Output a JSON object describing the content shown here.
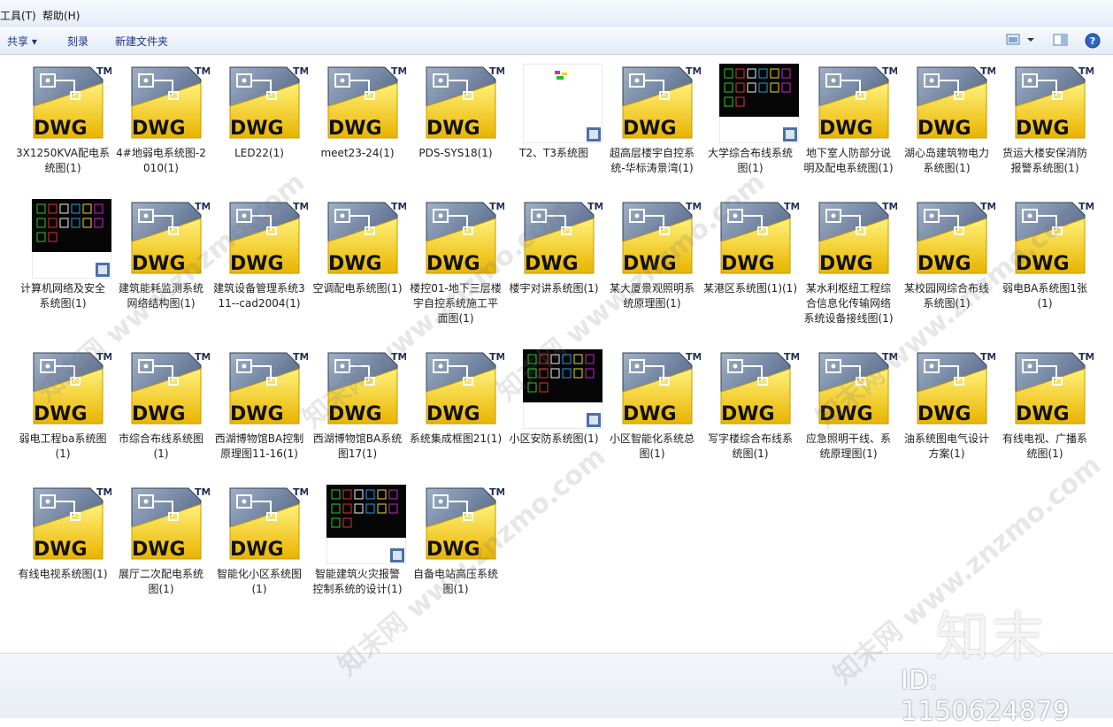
{
  "menu": {
    "tools": "工具(T)",
    "help": "帮助(H)"
  },
  "toolbar": {
    "share": "共享 ▾",
    "burn": "刻录",
    "new_folder": "新建文件夹"
  },
  "dwg_text": "DWG",
  "tm_text": "TM",
  "files": [
    {
      "type": "dwg",
      "label": "3X1250KVA配电系统图(1)"
    },
    {
      "type": "dwg",
      "label": "4#地弱电系统图-2010(1)"
    },
    {
      "type": "dwg",
      "label": "LED22(1)"
    },
    {
      "type": "dwg",
      "label": "meet23-24(1)"
    },
    {
      "type": "dwg",
      "label": "PDS-SYS18(1)"
    },
    {
      "type": "thumb-white",
      "label": "T2、T3系统图"
    },
    {
      "type": "dwg",
      "label": "超高层楼宇自控系统-华标涛景湾(1)"
    },
    {
      "type": "thumb-dark",
      "label": "大学综合布线系统图(1)"
    },
    {
      "type": "dwg",
      "label": "地下室人防部分说明及配电系统图(1)"
    },
    {
      "type": "dwg",
      "label": "湖心岛建筑物电力系统图(1)"
    },
    {
      "type": "dwg",
      "label": "货运大楼安保消防报警系统图(1)"
    },
    {
      "type": "thumb-dark",
      "label": "计算机网络及安全系统图(1)"
    },
    {
      "type": "dwg",
      "label": "建筑能耗监测系统网络结构图(1)"
    },
    {
      "type": "dwg",
      "label": "建筑设备管理系统311--cad2004(1)"
    },
    {
      "type": "dwg",
      "label": "空调配电系统图(1)"
    },
    {
      "type": "dwg",
      "label": "楼控01-地下三层楼宇自控系统施工平面图(1)"
    },
    {
      "type": "dwg",
      "label": "楼宇对讲系统图(1)"
    },
    {
      "type": "dwg",
      "label": "某大厦景观照明系统原理图(1)"
    },
    {
      "type": "dwg",
      "label": "某港区系统图(1)(1)"
    },
    {
      "type": "dwg",
      "label": "某水利枢纽工程综合信息化传输网络系统设备接线图(1)"
    },
    {
      "type": "dwg",
      "label": "某校园网综合布线系统图(1)"
    },
    {
      "type": "dwg",
      "label": "弱电BA系统图1张(1)"
    },
    {
      "type": "dwg",
      "label": "弱电工程ba系统图(1)"
    },
    {
      "type": "dwg",
      "label": "市综合布线系统图(1)"
    },
    {
      "type": "dwg",
      "label": "西湖博物馆BA控制原理图11-16(1)"
    },
    {
      "type": "dwg",
      "label": "西湖博物馆BA系统图17(1)"
    },
    {
      "type": "dwg",
      "label": "系统集成框图21(1)"
    },
    {
      "type": "thumb-dark",
      "label": "小区安防系统图(1)"
    },
    {
      "type": "dwg",
      "label": "小区智能化系统总图(1)"
    },
    {
      "type": "dwg",
      "label": "写字楼综合布线系统图(1)"
    },
    {
      "type": "dwg",
      "label": "应急照明干线、系统原理图(1)"
    },
    {
      "type": "dwg",
      "label": "油系统图电气设计方案(1)"
    },
    {
      "type": "dwg",
      "label": "有线电视、广播系统图(1)"
    },
    {
      "type": "dwg",
      "label": "有线电视系统图(1)"
    },
    {
      "type": "dwg",
      "label": "展厅二次配电系统图(1)"
    },
    {
      "type": "dwg",
      "label": "智能化小区系统图(1)"
    },
    {
      "type": "thumb-dark",
      "label": "智能建筑火灾报警控制系统的设计(1)"
    },
    {
      "type": "dwg",
      "label": "自备电站高压系统图(1)"
    }
  ],
  "watermark": {
    "brand": "知末",
    "id": "ID: 1150624879",
    "site": "知末网 www.znzmo.com"
  }
}
